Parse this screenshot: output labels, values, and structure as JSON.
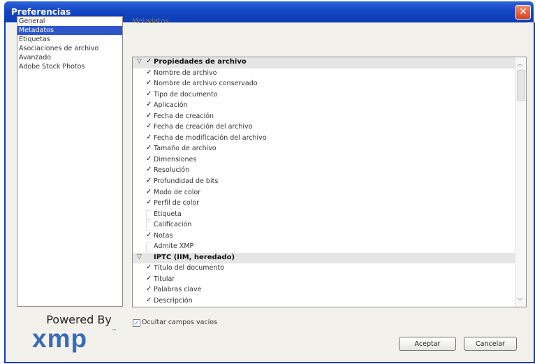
{
  "window": {
    "title": "Preferencias",
    "close_glyph": "✕"
  },
  "sidebar": {
    "items": [
      {
        "label": "General"
      },
      {
        "label": "Metadatos"
      },
      {
        "label": "Etiquetas"
      },
      {
        "label": "Asociaciones de archivo"
      },
      {
        "label": "Avanzado"
      },
      {
        "label": "Adobe Stock Photos"
      }
    ],
    "selected": "Metadatos"
  },
  "branding": {
    "powered_by": "Powered By",
    "logo": "xmp",
    "trademark": "™"
  },
  "main": {
    "section_title": "Metadatos",
    "rows": [
      {
        "label": "Propiedades de archivo",
        "header": true,
        "checked": true,
        "arrow": "▽"
      },
      {
        "label": "Nombre de archivo",
        "checked": true
      },
      {
        "label": "Nombre de archivo conservado",
        "checked": true
      },
      {
        "label": "Tipo de documento",
        "checked": true
      },
      {
        "label": "Aplicación",
        "checked": true
      },
      {
        "label": "Fecha de creación",
        "checked": true
      },
      {
        "label": "Fecha de creación del archivo",
        "checked": true
      },
      {
        "label": "Fecha de modificación del archivo",
        "checked": true
      },
      {
        "label": "Tamaño de archivo",
        "checked": true
      },
      {
        "label": "Dimensiones",
        "checked": true
      },
      {
        "label": "Resolución",
        "checked": true
      },
      {
        "label": "Profundidad de bits",
        "checked": true
      },
      {
        "label": "Modo de color",
        "checked": true
      },
      {
        "label": "Perfil de color",
        "checked": true
      },
      {
        "label": "Etiqueta",
        "checked": false
      },
      {
        "label": "Calificación",
        "checked": false
      },
      {
        "label": "Notas",
        "checked": true
      },
      {
        "label": "Admite XMP",
        "checked": false
      },
      {
        "label": "IPTC (IIM, heredado)",
        "header": true,
        "checked": false,
        "arrow": "▽"
      },
      {
        "label": "Título del documento",
        "checked": true
      },
      {
        "label": "Titular",
        "checked": true
      },
      {
        "label": "Palabras clave",
        "checked": true
      },
      {
        "label": "Descripción",
        "checked": true
      }
    ],
    "hide_empty": {
      "label": "Ocultar campos vacíos",
      "checked": true
    }
  },
  "buttons": {
    "ok": "Aceptar",
    "cancel": "Cancelar"
  },
  "colors": {
    "titlebar": "#1446c3",
    "selection": "#2f56c8",
    "logo": "#3a6bb8",
    "close": "#d4451f"
  }
}
